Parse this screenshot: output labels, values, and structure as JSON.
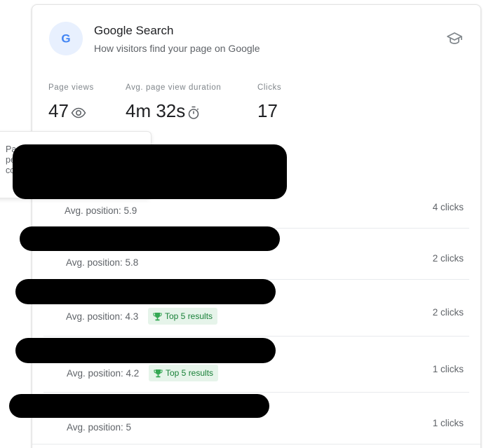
{
  "header": {
    "title": "Google Search",
    "subtitle": "How visitors find your page on Google",
    "logo_letter": "G"
  },
  "metrics": [
    {
      "label": "Page views",
      "value": "47",
      "icon": "eye-icon"
    },
    {
      "label": "Avg. page view duration",
      "value": "4m 32s",
      "icon": "timer-icon"
    },
    {
      "label": "Clicks",
      "value": "17"
    }
  ],
  "popover": {
    "lines": [
      "Pa",
      "pe",
      "co"
    ]
  },
  "queries": [
    {
      "avg_position": "Avg. position: 5.9",
      "clicks": "4 clicks",
      "badge": null
    },
    {
      "avg_position": "Avg. position: 5.8",
      "clicks": "2 clicks",
      "badge": null
    },
    {
      "avg_position": "Avg. position: 4.3",
      "clicks": "2 clicks",
      "badge": "Top 5 results"
    },
    {
      "avg_position": "Avg. position: 4.2",
      "clicks": "1 clicks",
      "badge": "Top 5 results"
    },
    {
      "avg_position": "Avg. position: 5",
      "clicks": "1 clicks",
      "badge": null
    }
  ],
  "colors": {
    "accent": "#4285f4",
    "badge_bg": "#e6f4ea",
    "badge_text": "#188038",
    "redaction": "#000000"
  }
}
